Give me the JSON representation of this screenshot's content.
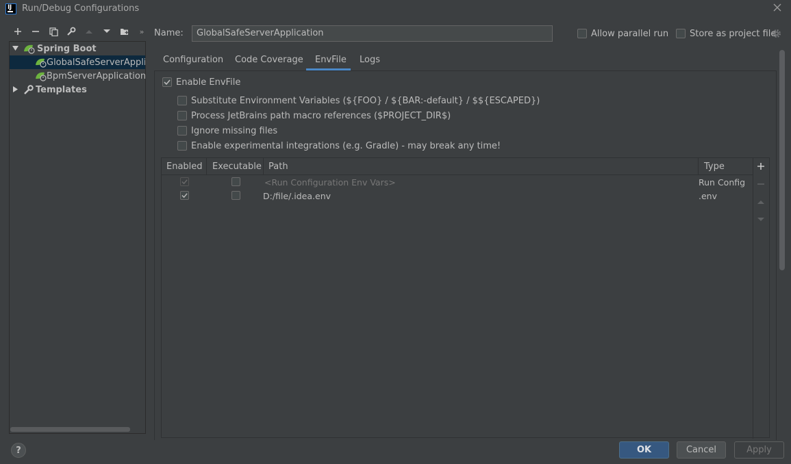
{
  "window": {
    "title": "Run/Debug Configurations",
    "app_icon_text": "IJ"
  },
  "tree": {
    "groups": [
      {
        "label": "Spring Boot",
        "expanded": true
      },
      {
        "label": "Templates",
        "expanded": false
      }
    ],
    "items": [
      {
        "label": "GlobalSafeServerApplica",
        "selected": true
      },
      {
        "label": "BpmServerApplication",
        "selected": false
      }
    ]
  },
  "name_field": {
    "label": "Name:",
    "value": "GlobalSafeServerApplication"
  },
  "options": {
    "allow_parallel_run": {
      "label": "Allow parallel run",
      "checked": false
    },
    "store_as_project_file": {
      "label": "Store as project file",
      "checked": false
    }
  },
  "tabs": [
    {
      "label": "Configuration",
      "active": false
    },
    {
      "label": "Code Coverage",
      "active": false
    },
    {
      "label": "EnvFile",
      "active": true
    },
    {
      "label": "Logs",
      "active": false
    }
  ],
  "envfile": {
    "enable": {
      "label": "Enable EnvFile",
      "checked": true
    },
    "sub_options": [
      {
        "label": "Substitute Environment Variables (${FOO} / ${BAR:-default} / $${ESCAPED})",
        "checked": false
      },
      {
        "label": "Process JetBrains path macro references ($PROJECT_DIR$)",
        "checked": false
      },
      {
        "label": "Ignore missing files",
        "checked": false
      },
      {
        "label": "Enable experimental integrations (e.g. Gradle) - may break any time!",
        "checked": false
      }
    ],
    "table": {
      "columns": [
        "Enabled",
        "Executable",
        "Path",
        "Type"
      ],
      "rows": [
        {
          "enabled": true,
          "enabled_disabled": true,
          "executable": false,
          "path": "<Run Configuration Env Vars>",
          "type": "Run Config",
          "muted": true
        },
        {
          "enabled": true,
          "enabled_disabled": false,
          "executable": false,
          "path": "D:/file/.idea.env",
          "type": ".env",
          "muted": false
        }
      ]
    }
  },
  "buttons": {
    "ok": "OK",
    "cancel": "Cancel",
    "apply": "Apply",
    "help": "?"
  },
  "colors": {
    "background": "#3c3f41",
    "accent": "#4a88c7",
    "ok_button": "#365880",
    "spring_green": "#6db33f"
  }
}
